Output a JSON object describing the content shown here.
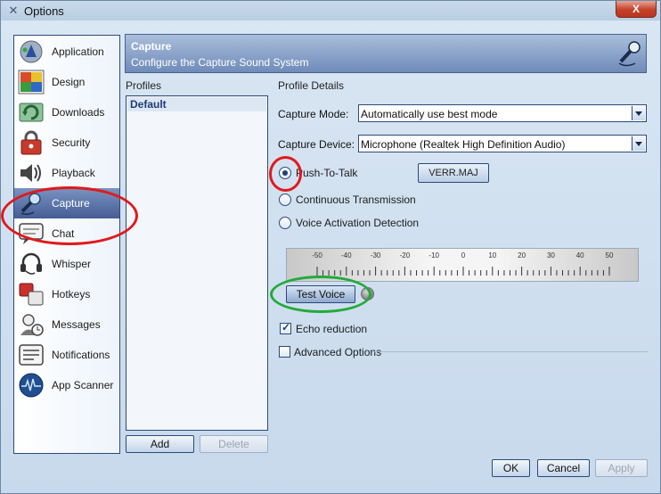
{
  "window": {
    "title": "Options",
    "close_label": "X"
  },
  "nav": {
    "items": [
      {
        "label": "Application",
        "icon": "application-icon"
      },
      {
        "label": "Design",
        "icon": "design-icon"
      },
      {
        "label": "Downloads",
        "icon": "downloads-icon"
      },
      {
        "label": "Security",
        "icon": "security-icon"
      },
      {
        "label": "Playback",
        "icon": "playback-icon"
      },
      {
        "label": "Capture",
        "icon": "microphone-icon",
        "selected": true
      },
      {
        "label": "Chat",
        "icon": "chat-icon"
      },
      {
        "label": "Whisper",
        "icon": "headset-icon"
      },
      {
        "label": "Hotkeys",
        "icon": "hotkeys-icon"
      },
      {
        "label": "Messages",
        "icon": "messages-icon"
      },
      {
        "label": "Notifications",
        "icon": "notifications-icon"
      },
      {
        "label": "App Scanner",
        "icon": "app-scanner-icon"
      }
    ]
  },
  "header": {
    "title": "Capture",
    "subtitle": "Configure the Capture Sound System",
    "icon": "microphone-icon"
  },
  "profiles": {
    "label": "Profiles",
    "items": [
      "Default"
    ],
    "selected": "Default",
    "add_label": "Add",
    "delete_label": "Delete"
  },
  "details": {
    "label": "Profile Details",
    "capture_mode_label": "Capture Mode:",
    "capture_mode_value": "Automatically use best mode",
    "capture_device_label": "Capture Device:",
    "capture_device_value": "Microphone (Realtek High Definition Audio)",
    "activation": {
      "selected": "Push-To-Talk",
      "options": [
        "Push-To-Talk",
        "Continuous Transmission",
        "Voice Activation Detection"
      ]
    },
    "hotkey_label": "VERR.MAJ",
    "meter": {
      "ticks": [
        "-50",
        "-40",
        "-30",
        "-20",
        "-10",
        "0",
        "10",
        "20",
        "30",
        "40",
        "50"
      ],
      "level": 0
    },
    "test_voice_label": "Test Voice",
    "echo_reduction_label": "Echo reduction",
    "echo_reduction_checked": true,
    "advanced_options_label": "Advanced Options",
    "advanced_options_checked": false
  },
  "footer": {
    "ok_label": "OK",
    "cancel_label": "Cancel",
    "apply_label": "Apply"
  },
  "colors": {
    "selected_nav": "#455d94",
    "header_band": "#6f8bb9",
    "annotation_red": "#e0191c",
    "annotation_green": "#22aa3a"
  }
}
